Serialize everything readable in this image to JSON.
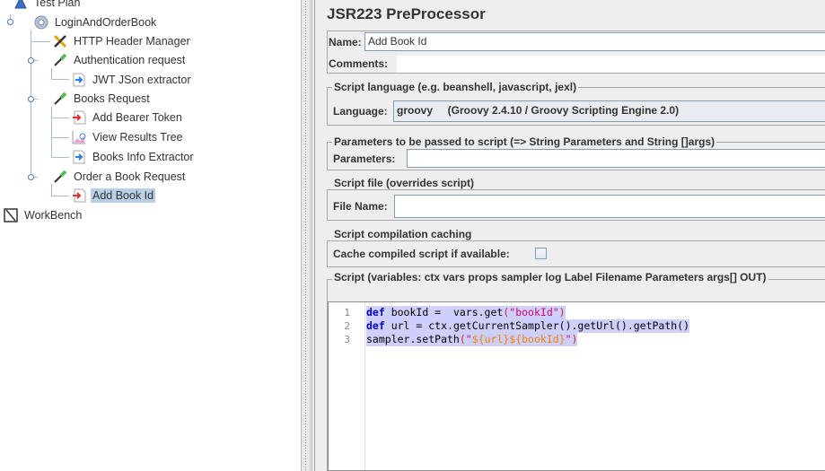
{
  "tree": {
    "nodes": [
      {
        "label": "Test Plan",
        "icon": "flask-icon"
      },
      {
        "label": "LoginAndOrderBook",
        "icon": "gear-icon"
      },
      {
        "label": "HTTP Header Manager",
        "icon": "wrench-screwdriver-icon"
      },
      {
        "label": "Authentication request",
        "icon": "pipette-icon"
      },
      {
        "label": "JWT JSon extractor",
        "icon": "extractor-icon"
      },
      {
        "label": "Books Request",
        "icon": "pipette-icon"
      },
      {
        "label": "Add Bearer Token",
        "icon": "preprocessor-icon"
      },
      {
        "label": "View Results Tree",
        "icon": "chart-listener-icon"
      },
      {
        "label": "Books Info Extractor",
        "icon": "extractor-icon"
      },
      {
        "label": "Order a Book Request",
        "icon": "pipette-icon"
      },
      {
        "label": "Add Book Id",
        "icon": "preprocessor-icon",
        "selected": true
      },
      {
        "label": "WorkBench",
        "icon": "workbench-icon"
      }
    ]
  },
  "panel": {
    "title": "JSR223 PreProcessor",
    "name_label": "Name:",
    "name_value": "Add Book Id",
    "comments_label": "Comments:",
    "comments_value": "",
    "language_group": "Script language (e.g. beanshell, javascript, jexl)",
    "language_label": "Language:",
    "language_value": "groovy     (Groovy 2.4.10 / Groovy Scripting Engine 2.0)",
    "params_group": "Parameters to be passed to script (=> String Parameters and String []args)",
    "params_label": "Parameters:",
    "params_value": "",
    "file_group": "Script file (overrides script)",
    "file_label": "File Name:",
    "file_value": "",
    "cache_group": "Script compilation caching",
    "cache_label": "Cache compiled script if available:",
    "cache_checked": false,
    "script_group": "Script (variables: ctx vars props sampler log Label Filename Parameters args[] OUT)"
  },
  "script": {
    "line_numbers": [
      "1",
      "2",
      "3"
    ],
    "lines": [
      {
        "kw": "def",
        "a": " bookId =  vars.get",
        "p1": "(",
        "s": "\"bookId\"",
        "p2": ")"
      },
      {
        "kw": "def",
        "a": " url = ctx.getCurrentSampler",
        "b": "().getUrl().getPath()"
      },
      {
        "a": "sampler.setPath",
        "p1": "(",
        "q1": "\"",
        "t": "${url}${bookId}",
        "q2": "\"",
        "p2": ")"
      }
    ]
  }
}
